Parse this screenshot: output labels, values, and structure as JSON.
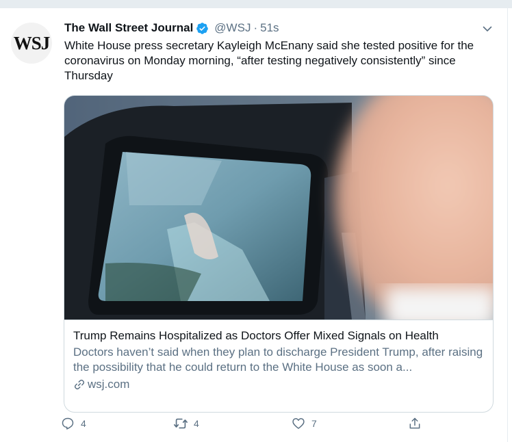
{
  "tweet": {
    "display_name": "The Wall Street Journal",
    "avatar_text": "WSJ",
    "handle": "@WSJ",
    "separator": "·",
    "time": "51s",
    "text": "White House press secretary Kayleigh McEnany said she tested positive for the coronavirus on Monday morning, “after testing negatively consistently” since Thursday",
    "verified_color": "#1da1f2"
  },
  "card": {
    "title": "Trump Remains Hospitalized as Doctors Offer Mixed Signals on Health",
    "description": "Doctors haven’t said when they plan to discharge President Trump, after raising the possibility that he could return to the White House as soon a...",
    "domain": "wsj.com"
  },
  "actions": {
    "reply": {
      "icon": "reply-icon",
      "count": "4"
    },
    "retweet": {
      "icon": "retweet-icon",
      "count": "4"
    },
    "like": {
      "icon": "heart-icon",
      "count": "7"
    },
    "share": {
      "icon": "share-icon"
    }
  },
  "colors": {
    "text": "#0f1419",
    "secondary": "#5b7083",
    "border": "#cfd9de",
    "background_gap": "#e6ecf0"
  }
}
